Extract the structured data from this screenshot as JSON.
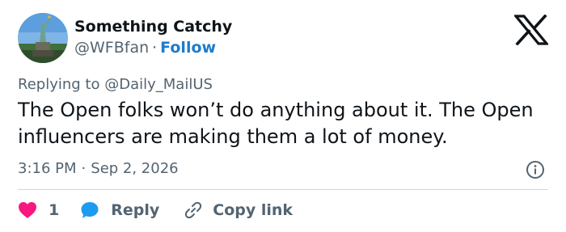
{
  "author": {
    "name": "Something Catchy",
    "handle": "@WFBfan",
    "separator": "·",
    "follow_label": "Follow",
    "avatar_icon": "statue-of-liberty-avatar"
  },
  "platform_icon": "x-logo-icon",
  "reply_context": {
    "prefix": "Replying to",
    "mention": "@Daily_MailUS"
  },
  "tweet": {
    "text": "The Open folks won’t do anything about it. The Open influencers are making them a lot of money."
  },
  "meta": {
    "time": "3:16 PM",
    "separator": "·",
    "date": "Sep 2, 2026",
    "info_icon": "info-icon"
  },
  "actions": {
    "like_icon": "heart-icon",
    "like_count": "1",
    "reply_icon": "reply-bubble-icon",
    "reply_label": "Reply",
    "copy_icon": "link-icon",
    "copy_label": "Copy link"
  },
  "colors": {
    "accent": "#1d7bcd",
    "like": "#f91880",
    "reply_bubble": "#1d9bf0",
    "secondary_text": "#536471"
  }
}
